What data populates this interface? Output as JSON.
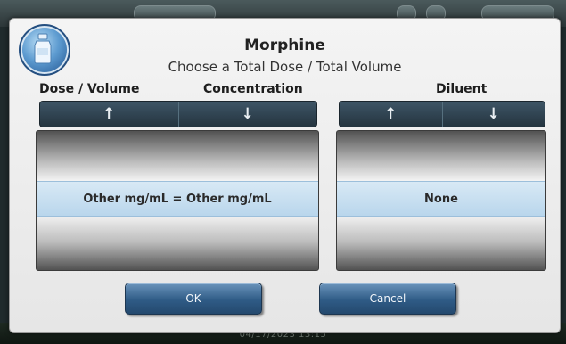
{
  "header": {
    "title": "Morphine",
    "subtitle": "Choose a Total Dose / Total Volume"
  },
  "columns": {
    "dose_volume": "Dose / Volume",
    "concentration": "Concentration",
    "diluent": "Diluent"
  },
  "pickers": {
    "concentration_selected": "Other mg/mL = Other mg/mL",
    "diluent_selected": "None"
  },
  "arrows": {
    "up": "↑",
    "down": "↓"
  },
  "buttons": {
    "ok": "OK",
    "cancel": "Cancel"
  },
  "status": {
    "timestamp": "04/17/2023 13:15"
  },
  "icons": {
    "drug": "medication-bottle-icon"
  },
  "colors": {
    "accent": "#2f5b86",
    "selection": "#c6def0"
  }
}
